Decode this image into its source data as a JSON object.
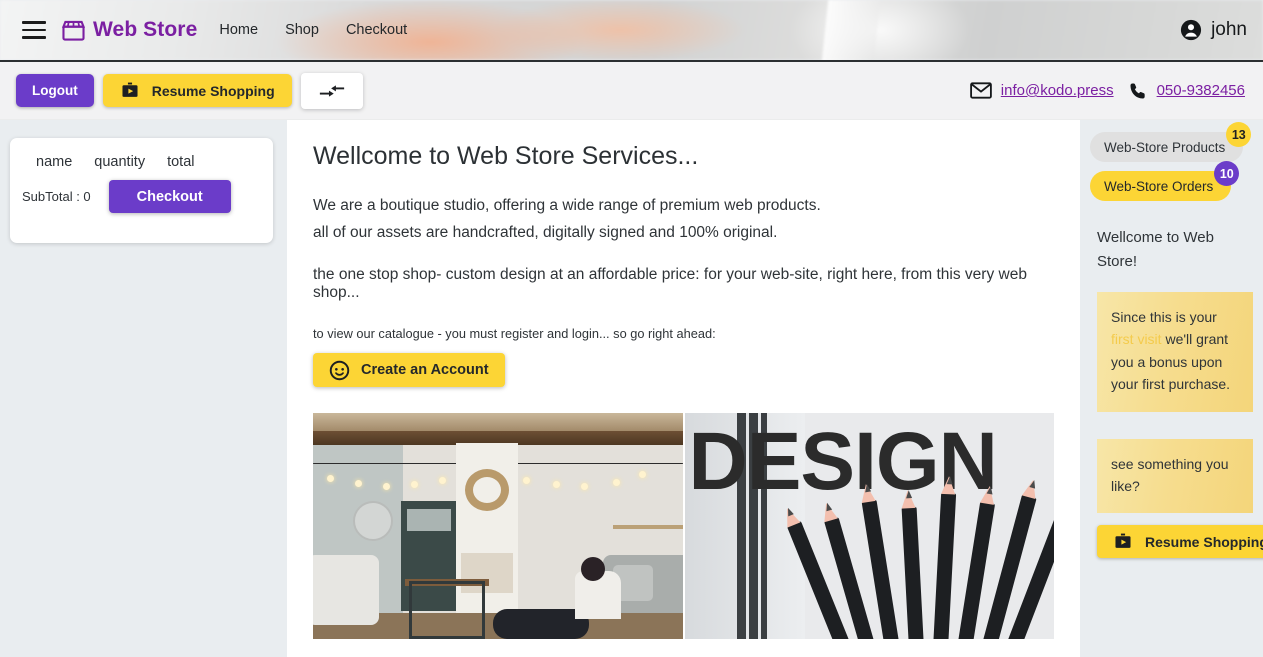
{
  "topnav": {
    "menu_icon": "hamburger-menu-icon",
    "store_icon": "storefront-icon",
    "brand": "Web Store",
    "links": [
      {
        "label": "Home"
      },
      {
        "label": "Shop"
      },
      {
        "label": "Checkout"
      }
    ],
    "account_icon": "account-circle-icon",
    "username": "john"
  },
  "toolbar": {
    "logout_label": "Logout",
    "resume_label": "Resume Shopping",
    "resume_icon": "work-play-briefcase-icon",
    "compress_icon": "compress-arrows-icon",
    "email_icon": "mail-icon",
    "email": "info@kodo.press",
    "phone_icon": "phone-icon",
    "phone": "050-9382456"
  },
  "cart": {
    "columns": [
      "name",
      "quantity",
      "total"
    ],
    "subtotal_label": "SubTotal : 0",
    "checkout_label": "Checkout"
  },
  "main": {
    "title": "Wellcome to Web Store Services...",
    "paragraphs": [
      "We are a boutique studio, offering a wide range of premium web products.",
      "all of our assets are handcrafted, digitally signed and 100% original.",
      "the one stop shop- custom design at an affordable price: for your web-site, right here, from this very web shop..."
    ],
    "register_note": "to view our catalogue - you must register and login... so go right ahead:",
    "create_account_label": "Create an Account",
    "create_account_icon": "child-face-icon",
    "gallery": [
      {
        "name": "loft-living-room-photo",
        "alt": "Woman working on laptop in a bright loft living room with string lights"
      },
      {
        "name": "design-pencils-photo",
        "alt": "Poster reading DESIGN above a fan of black pencils",
        "word": "DESIGN"
      }
    ]
  },
  "sidebar": {
    "pills": [
      {
        "label": "Web-Store Products",
        "badge": "13"
      },
      {
        "label": "Web-Store Orders",
        "badge": "10"
      }
    ],
    "welcome": "Wellcome to Web Store!",
    "notes": [
      {
        "before": "Since this is your ",
        "highlight": "first visit",
        "after": " we'll grant you a bonus upon your first purchase."
      },
      {
        "before": "see something you like?",
        "highlight": "",
        "after": ""
      }
    ],
    "resume_label": "Resume Shopping",
    "resume_icon": "work-play-briefcase-icon"
  },
  "colors": {
    "brand_purple": "#7b1fa2",
    "action_purple": "#6b3cc9",
    "accent_yellow": "#fcd535",
    "page_bg": "#e9edf0",
    "toolbar_bg": "#f2f2f3",
    "note_bg": "#f6dd8f"
  }
}
